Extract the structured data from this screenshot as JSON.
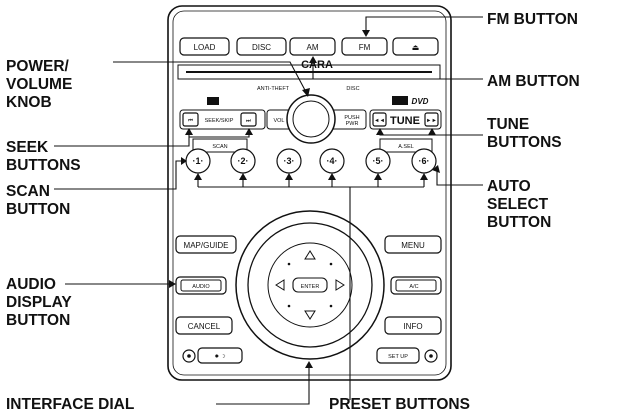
{
  "callouts": {
    "fm_button": "FM BUTTON",
    "power_volume_knob": [
      "POWER/",
      "VOLUME",
      "KNOB"
    ],
    "am_button": "AM BUTTON",
    "seek_buttons": [
      "SEEK",
      "BUTTONS"
    ],
    "tune_buttons": [
      "TUNE",
      "BUTTONS"
    ],
    "scan_button": [
      "SCAN",
      "BUTTON"
    ],
    "auto_select_button": [
      "AUTO",
      "SELECT",
      "BUTTON"
    ],
    "audio_display_button": [
      "AUDIO",
      "DISPLAY",
      "BUTTON"
    ],
    "interface_dial": "INTERFACE DIAL",
    "preset_buttons": "PRESET BUTTONS"
  },
  "unit": {
    "top_buttons": [
      "LOAD",
      "DISC",
      "AM",
      "FM",
      "⏏"
    ],
    "brand": "CARA",
    "anti_theft": "ANTI-THEFT",
    "disc_indicator": "DISC",
    "seek_label": "SEEK/SKIP",
    "seek_prev": "⏮",
    "seek_next": "⏭",
    "vol": "VOL",
    "push_pwr": [
      "PUSH",
      "PWR"
    ],
    "tune": "TUNE",
    "tune_prev": "◄◄",
    "tune_next": "►►",
    "scan": "SCAN",
    "a_sel": "A.SEL",
    "presets": [
      "·1·",
      "·2·",
      "·3·",
      "·4·",
      "·5·",
      "·6·"
    ],
    "map_guide": "MAP/GUIDE",
    "menu": "MENU",
    "audio": "AUDIO",
    "ac": "A/C",
    "cancel": "CANCEL",
    "info": "INFO",
    "enter": "ENTER",
    "setup": "SET UP",
    "brightness": "✹ ☽"
  }
}
